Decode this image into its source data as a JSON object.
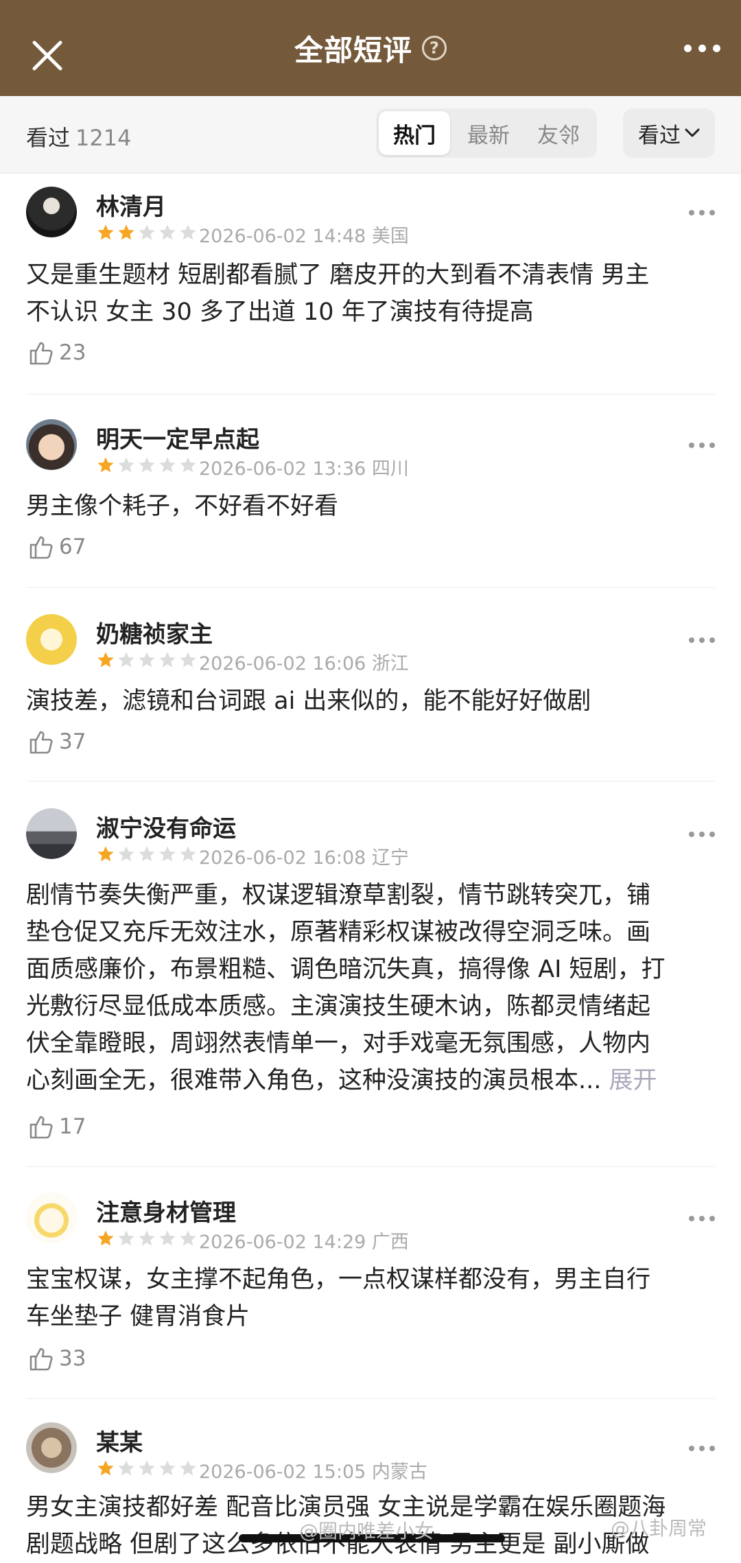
{
  "header": {
    "title": "全部短评",
    "help_icon": "?"
  },
  "filters": {
    "watched_label": "看过",
    "watched_count": "1214",
    "tabs": [
      "热门",
      "最新",
      "友邻"
    ],
    "active_tab": "热门",
    "dropdown_label": "看过"
  },
  "colors": {
    "header_bg": "#74593b",
    "star_on": "#f5a623",
    "star_off": "#dcdcdc"
  },
  "comments": [
    {
      "user": "林清月",
      "rating": 2,
      "date": "2026-06-02 14:48",
      "location": "美国",
      "lines": [
        "又是重生题材 短剧都看腻了 磨皮开的大到看不清表情 男主",
        "不认识 女主 30 多了出道 10 年了演技有待提高"
      ],
      "likes": "23"
    },
    {
      "user": "明天一定早点起",
      "rating": 1,
      "date": "2026-06-02 13:36",
      "location": "四川",
      "lines": [
        "男主像个耗子，不好看不好看"
      ],
      "likes": "67"
    },
    {
      "user": "奶糖祯家主",
      "rating": 1,
      "date": "2026-06-02 16:06",
      "location": "浙江",
      "lines": [
        "演技差，滤镜和台词跟 ai 出来似的，能不能好好做剧"
      ],
      "likes": "37"
    },
    {
      "user": "淑宁没有命运",
      "rating": 1,
      "date": "2026-06-02 16:08",
      "location": "辽宁",
      "lines": [
        "剧情节奏失衡严重，权谋逻辑潦草割裂，情节跳转突兀，铺",
        "垫仓促又充斥无效注水，原著精彩权谋被改得空洞乏味。画",
        "面质感廉价，布景粗糙、调色暗沉失真，搞得像 AI 短剧，打",
        "光敷衍尽显低成本质感。主演演技生硬木讷，陈都灵情绪起",
        "伏全靠瞪眼，周翊然表情单一，对手戏毫无氛围感，人物内",
        "心刻画全无，很难带入角色，这种没演技的演员根本..."
      ],
      "expand": "展开",
      "likes": "17"
    },
    {
      "user": "注意身材管理",
      "rating": 1,
      "date": "2026-06-02 14:29",
      "location": "广西",
      "lines": [
        "宝宝权谋，女主撑不起角色，一点权谋样都没有，男主自行",
        "车坐垫子 健胃消食片"
      ],
      "likes": "33"
    },
    {
      "user": "某某",
      "rating": 1,
      "date": "2026-06-02 15:05",
      "location": "内蒙古",
      "lines": [
        "男女主演技都好差 配音比演员强 女主说是学霸在娱乐圈题海",
        "剧题战略 但剧了这么多依旧不能大表情 男主更是 副小厮做"
      ],
      "likes": ""
    }
  ],
  "watermarks": {
    "left": "@圈内唯差小女",
    "right": "@八卦周常"
  }
}
